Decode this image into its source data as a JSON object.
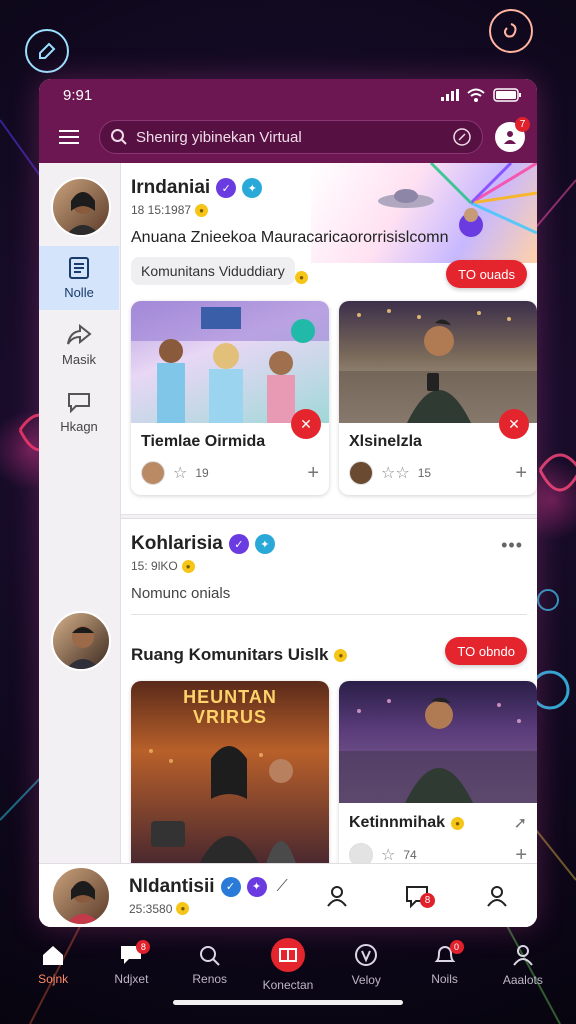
{
  "status": {
    "time": "9:91"
  },
  "search": {
    "placeholder": "Shenirg yibinekan Virtual"
  },
  "profile_badge": "7",
  "rail": {
    "items": [
      {
        "label": "Nolle",
        "icon": "news-icon",
        "active": true
      },
      {
        "label": "Masik",
        "icon": "share-icon",
        "active": false
      },
      {
        "label": "Hkagn",
        "icon": "chat-icon",
        "active": false
      }
    ]
  },
  "post1": {
    "author": "Irndaniai",
    "time": "18 15:1987",
    "text": "Anuana Znieekoa Mauracaricaororrisislcomn",
    "chip": "Komunitans Viduddiary",
    "follow": "TO ouads",
    "cards": [
      {
        "title": "Tiemlae Oirmida",
        "rating": "19"
      },
      {
        "title": "Xlsinelzla",
        "rating": "15"
      }
    ]
  },
  "post2": {
    "author": "Kohlarisia",
    "time": "15: 9lKO",
    "subtitle": "Nomunc onials",
    "section": "Ruang Komunitars Uislk",
    "follow": "TO obndo",
    "poster_text": [
      "HEUNTAN",
      "VRIRUS"
    ],
    "cards": [
      {
        "title": ""
      },
      {
        "title": "Ketinnmihak",
        "meta": "74"
      }
    ]
  },
  "bottom_user": {
    "name": "Nldantisii",
    "time": "25:3580",
    "icon_badge": "8"
  },
  "tabs": [
    {
      "label": "Sojnk",
      "icon": "home-icon",
      "active": true
    },
    {
      "label": "Ndjxet",
      "icon": "message-icon",
      "badge": "8"
    },
    {
      "label": "Renos",
      "icon": "search-icon"
    },
    {
      "label": "Konectan",
      "icon": "grid-icon",
      "center": true
    },
    {
      "label": "Veloy",
      "icon": "compass-icon"
    },
    {
      "label": "Noils",
      "icon": "bell-icon",
      "badge": "0"
    },
    {
      "label": "Aaalots",
      "icon": "profile-icon"
    }
  ],
  "colors": {
    "brand": "#6d1752",
    "accent_red": "#e5252d",
    "rail_active": "#d4e4fb",
    "tab_active": "#ff8a6a"
  }
}
